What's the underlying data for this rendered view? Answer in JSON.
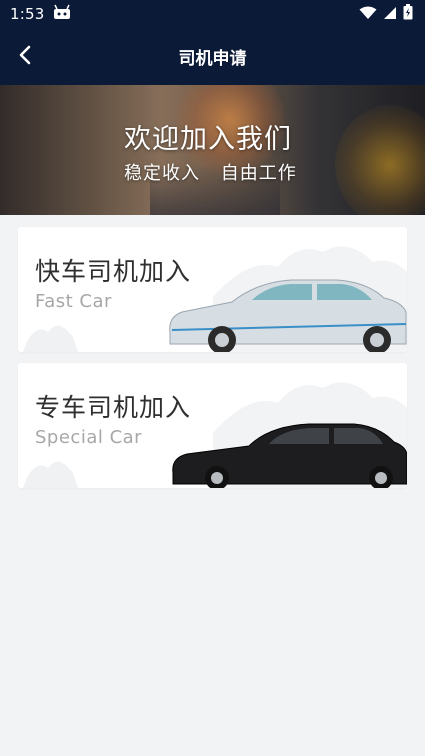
{
  "status_bar": {
    "time": "1:53",
    "icons": [
      "android-notification-icon",
      "wifi-icon",
      "signal-icon",
      "battery-icon"
    ]
  },
  "header": {
    "title": "司机申请",
    "back_icon": "chevron-left-icon"
  },
  "banner": {
    "title": "欢迎加入我们",
    "subtitle_left": "稳定收入",
    "subtitle_right": "自由工作"
  },
  "cards": [
    {
      "title": "快车司机加入",
      "subtitle": "Fast Car",
      "car_color": "#d6dde3"
    },
    {
      "title": "专车司机加入",
      "subtitle": "Special Car",
      "car_color": "#1d1d20"
    }
  ],
  "colors": {
    "header_bg": "#0a1a37",
    "page_bg": "#f2f3f5",
    "card_bg": "#ffffff",
    "subtitle_gray": "#a7a7a7"
  }
}
